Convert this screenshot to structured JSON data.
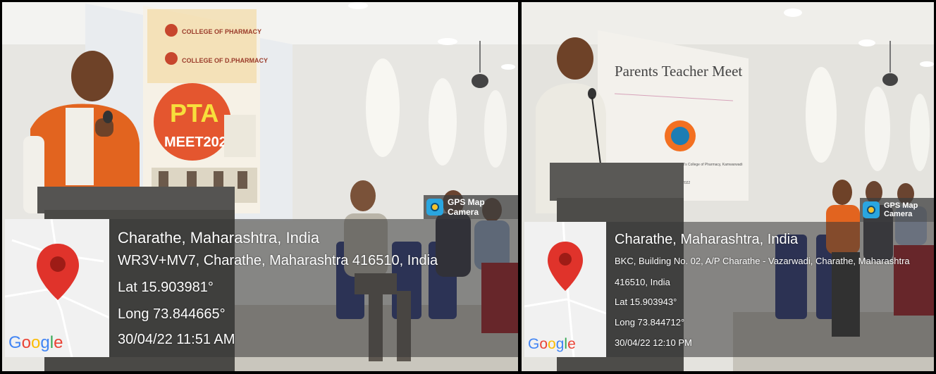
{
  "panels": [
    {
      "slide": {
        "line1": "COLLEGE OF PHARMACY",
        "line2": "COLLEGE OF D.PHARMACY",
        "badge": "PTA",
        "event": "MEET2022"
      },
      "badge_label": "GPS Map Camera",
      "location": "Charathe, Maharashtra, India",
      "address": [
        "WR3V+MV7, Charathe, Maharashtra 416510, India"
      ],
      "lat": "Lat 15.903981°",
      "long": "Long 73.844665°",
      "datetime": "30/04/22 11:51 AM",
      "map_brand": "Google"
    },
    {
      "slide": {
        "title": "Parents Teacher Meet",
        "college": "Shramsa Shikshan Prasarak Mandal's College of Pharmacy, Kamwarwadi",
        "date": "30 April 2022"
      },
      "badge_label": "GPS Map Camera",
      "location": "Charathe, Maharashtra, India",
      "address": [
        "BKC, Building No. 02, A/P Charathe - Vazarwadi, Charathe, Maharashtra",
        "416510, India"
      ],
      "lat": "Lat 15.903943°",
      "long": "Long 73.844712°",
      "datetime": "30/04/22 12:10 PM",
      "map_brand": "Google"
    }
  ],
  "colors": {
    "google_blue": "#4285F4",
    "google_red": "#EA4335",
    "google_yellow": "#FBBC05",
    "google_green": "#34A853",
    "pin_red": "#e0332b",
    "ptm_orange": "#f37021"
  },
  "icons": [
    "map-pin-icon",
    "gps-camera-app-icon"
  ]
}
